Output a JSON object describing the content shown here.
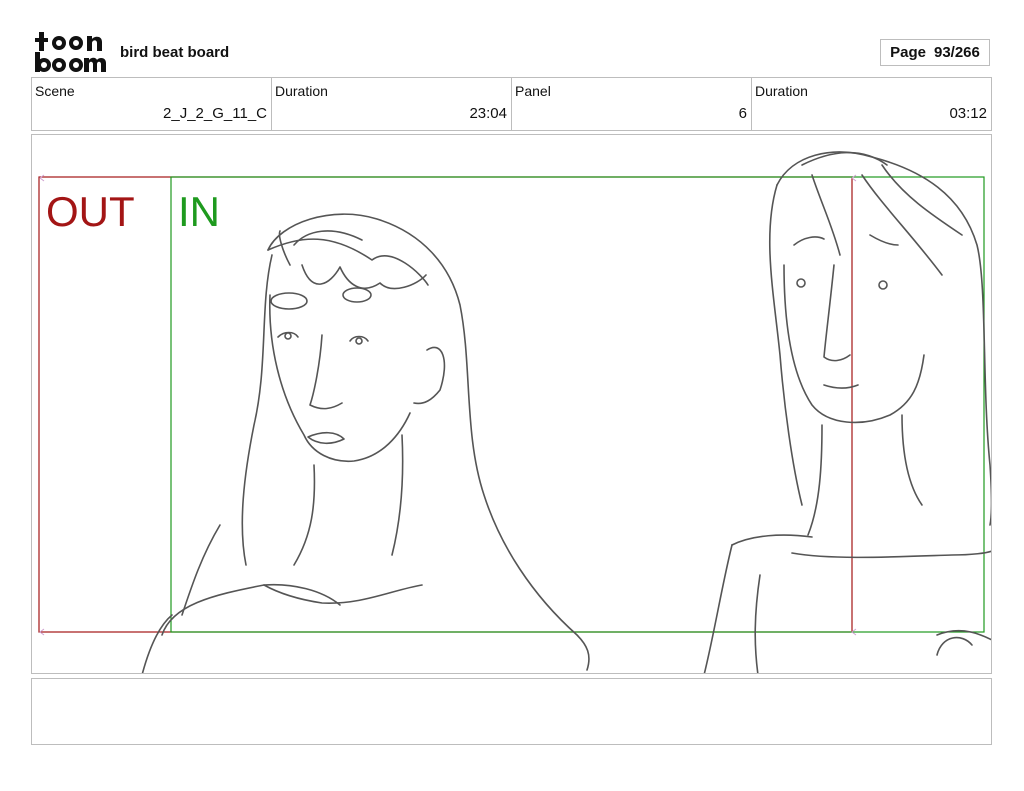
{
  "header": {
    "brand": "toonboom",
    "title": "bird beat board",
    "page_label": "Page",
    "page_value": "93/266"
  },
  "info": {
    "scene_label": "Scene",
    "scene_value": "2_J_2_G_11_C",
    "scene_duration_label": "Duration",
    "scene_duration_value": "23:04",
    "panel_label": "Panel",
    "panel_value": "6",
    "panel_duration_label": "Duration",
    "panel_duration_value": "03:12"
  },
  "panel": {
    "out_label": "OUT",
    "in_label": "IN",
    "out_color": "#a31515",
    "in_color": "#1e9a1e"
  },
  "caption": {
    "text": ""
  }
}
